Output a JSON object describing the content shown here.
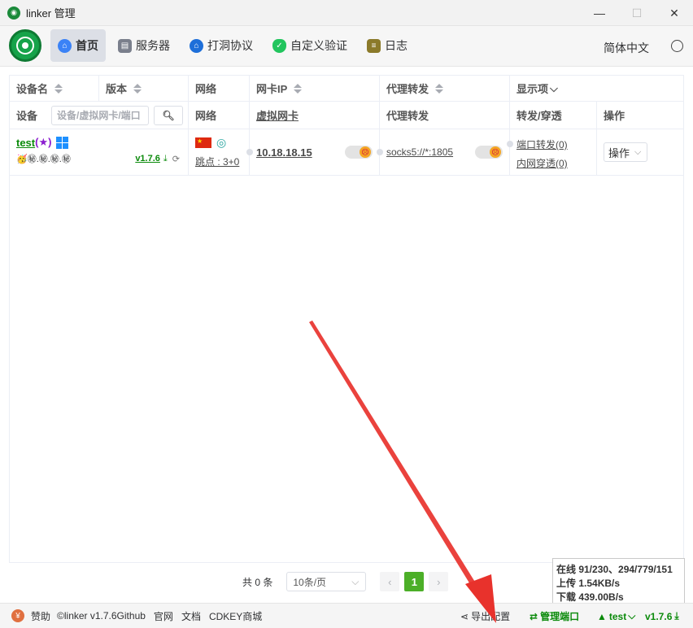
{
  "window": {
    "title": "linker 管理",
    "minimize": "—",
    "maximize": "☐",
    "close": "✕"
  },
  "nav": {
    "items": [
      {
        "label": "首页",
        "icon": "home-icon"
      },
      {
        "label": "服务器",
        "icon": "server-icon"
      },
      {
        "label": "打洞协议",
        "icon": "tunnel-icon"
      },
      {
        "label": "自定义验证",
        "icon": "shield-icon"
      },
      {
        "label": "日志",
        "icon": "log-icon"
      }
    ],
    "language": "简体中文"
  },
  "table": {
    "headers": {
      "device": "设备名",
      "version": "版本",
      "network": "网络",
      "nic_ip": "网卡IP",
      "proxy": "代理转发",
      "display": "显示项"
    },
    "subheaders": {
      "device": "设备",
      "search_placeholder": "设备/虚拟网卡/端口",
      "network": "网络",
      "vnic": "虚拟网卡",
      "proxy": "代理转发",
      "forward": "转发/穿透",
      "ops": "操作"
    },
    "rows": [
      {
        "name": "test",
        "star": "(★)",
        "badges": "🥳㊙.㊙.㊙.㊙",
        "version": "v1.7.6",
        "hops": "跳点 : 3+0",
        "ip": "10.18.18.15",
        "proxy": "socks5://*:1805",
        "port_forward": "端口转发(0)",
        "intranet": "内网穿透(0)",
        "op": "操作"
      }
    ]
  },
  "pager": {
    "total": "共 0 条",
    "page_size": "10条/页",
    "current_page": "1",
    "prev": "‹",
    "next": "›"
  },
  "stats": {
    "online": "在线 91/230、294/779/151",
    "upload": "上传 1.54KB/s",
    "download": "下载 439.00B/s"
  },
  "footer": {
    "sponsor": "赞助",
    "copyright": "©linker v1.7.6Github",
    "site": "官网",
    "docs": "文档",
    "store": "CDKEY商城",
    "export": "导出配置",
    "manage_port": "管理端口",
    "device": "test",
    "version": "v1.7.6"
  }
}
